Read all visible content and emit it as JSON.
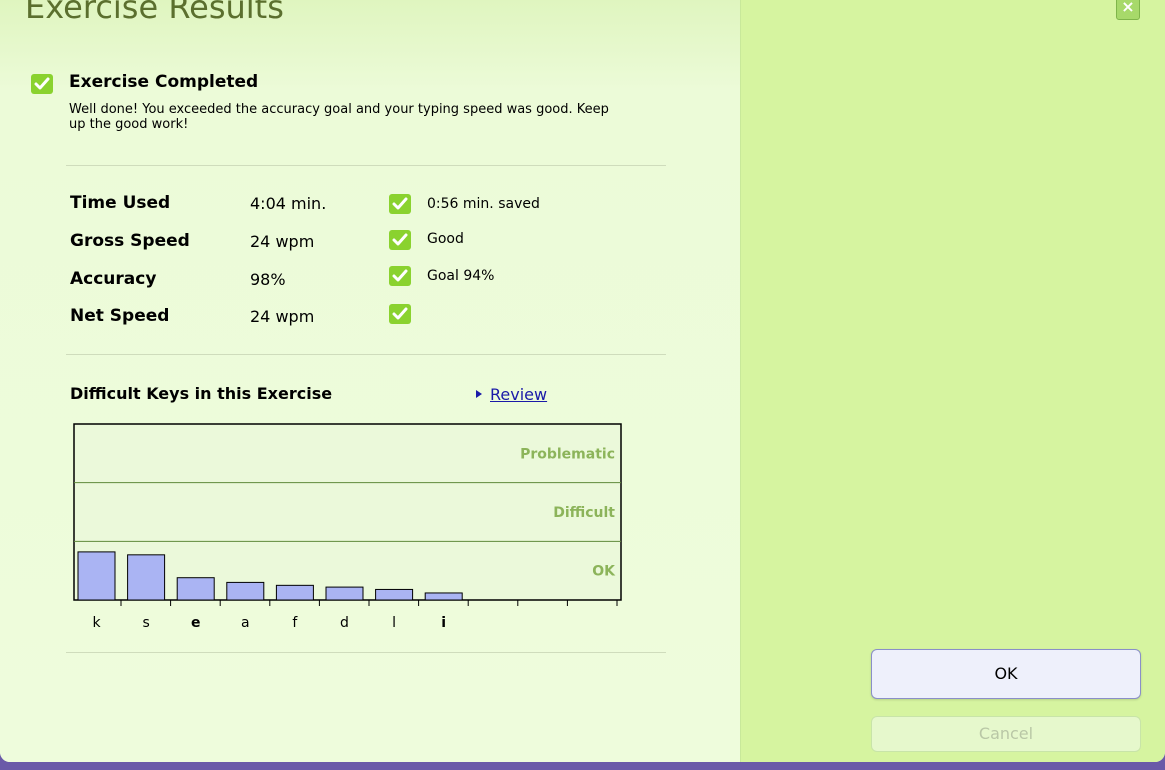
{
  "window": {
    "title": "Exercise Results",
    "close_glyph": "×"
  },
  "summary": {
    "heading": "Exercise Completed",
    "message": "Well done! You exceeded the accuracy goal and your typing speed was good. Keep up the good work!"
  },
  "stats": [
    {
      "label": "Time Used",
      "value": "4:04 min.",
      "note": "0:56 min.  saved",
      "icon": "check-icon"
    },
    {
      "label": "Gross Speed",
      "value": "24 wpm",
      "note": "Good",
      "icon": "check-icon"
    },
    {
      "label": "Accuracy",
      "value": "98%",
      "note": "Goal 94%",
      "icon": "check-icon"
    },
    {
      "label": "Net Speed",
      "value": "24 wpm",
      "note": "",
      "icon": "check-icon"
    }
  ],
  "difficult_keys": {
    "heading": "Difficult Keys in this Exercise",
    "review_label": "Review"
  },
  "chart_data": {
    "type": "bar",
    "categories": [
      "k",
      "s",
      "e",
      "a",
      "f",
      "d",
      "l",
      "i",
      "",
      "",
      ""
    ],
    "bold_categories": [
      "e",
      "i"
    ],
    "values": [
      0.82,
      0.77,
      0.38,
      0.3,
      0.25,
      0.22,
      0.18,
      0.12,
      0,
      0,
      0
    ],
    "bands": [
      "OK",
      "Difficult",
      "Problematic"
    ],
    "ylim": [
      0,
      3
    ],
    "bar_color": "#aab4f3",
    "band_label_color": "#8cb45a"
  },
  "buttons": {
    "ok_label": "OK",
    "cancel_label": "Cancel"
  },
  "colors": {
    "accent_green": "#8ad22f",
    "title_color": "#5b6f2e",
    "link_color": "#1a1aa8"
  }
}
